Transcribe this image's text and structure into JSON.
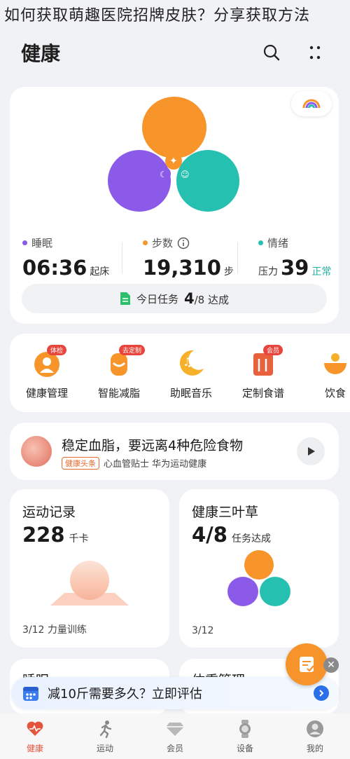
{
  "watermark": "如何获取萌趣医院招牌皮肤？分享获取方法",
  "header": {
    "title": "健康"
  },
  "clover": {
    "colors": {
      "activity": "#f7942a",
      "sleep": "#8c5ae8",
      "mood": "#25c0b0"
    },
    "metrics": [
      {
        "label": "睡眠",
        "value": "06:36",
        "unit": "起床",
        "color": "#8c5ae8"
      },
      {
        "label": "步数",
        "value": "19,310",
        "unit": "步",
        "color": "#f7942a"
      },
      {
        "label": "情绪",
        "value": "39",
        "prefix": "压力",
        "status": "正常",
        "color": "#25c0b0"
      }
    ],
    "task": {
      "prefix": "今日任务",
      "done": "4",
      "total": "/8 达成"
    }
  },
  "services": [
    {
      "label": "健康管理",
      "badge": "体检",
      "color": "#f7942a"
    },
    {
      "label": "智能减脂",
      "badge": "去定制",
      "color": "#f7942a"
    },
    {
      "label": "助眠音乐",
      "badge": "",
      "color": "#f7b02a"
    },
    {
      "label": "定制食谱",
      "badge": "会员",
      "color": "#e8603c"
    },
    {
      "label": "饮食",
      "badge": "",
      "color": "#f7942a"
    }
  ],
  "article": {
    "title": "稳定血脂，要远离4种危险食物",
    "tag": "健康头条",
    "source": "心血管贴士 华为运动健康"
  },
  "exercise": {
    "title": "运动记录",
    "value": "228",
    "unit": "千卡",
    "footer": "3/12 力量训练"
  },
  "clover_mini": {
    "title": "健康三叶草",
    "value": "4/8",
    "unit": "任务达成",
    "footer": "3/12"
  },
  "peek": {
    "left": "睡眠",
    "right": "体重管理"
  },
  "banner": {
    "text": "减10斤需要多久？立即评估"
  },
  "nav": [
    {
      "label": "健康",
      "active": true
    },
    {
      "label": "运动",
      "active": false
    },
    {
      "label": "会员",
      "active": false
    },
    {
      "label": "设备",
      "active": false
    },
    {
      "label": "我的",
      "active": false
    }
  ]
}
